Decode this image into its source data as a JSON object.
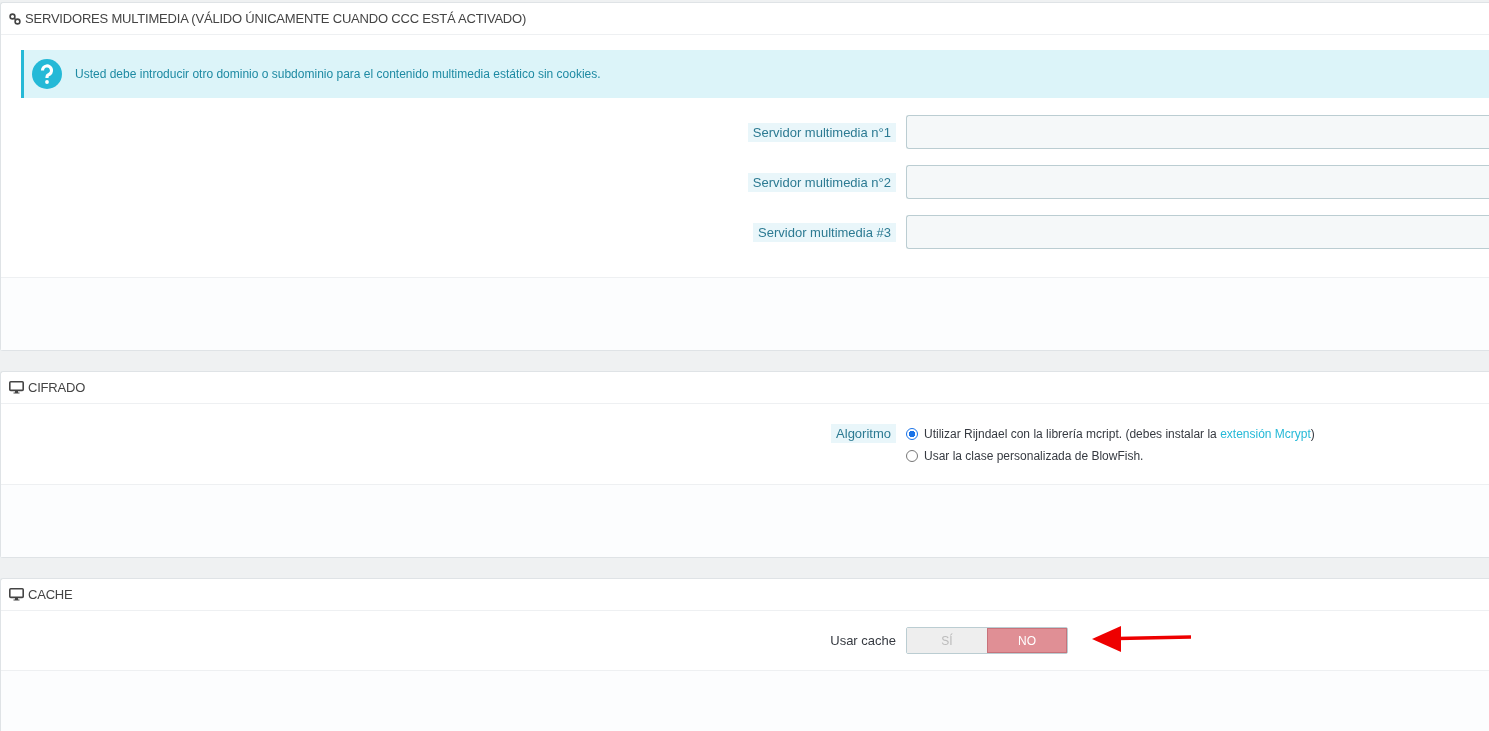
{
  "media_panel": {
    "title": "SERVIDORES MULTIMEDIA (VÁLIDO ÚNICAMENTE CUANDO CCC ESTÁ ACTIVADO)",
    "alert": "Usted debe introducir otro dominio o subdominio para el contenido multimedia estático sin cookies.",
    "fields": [
      {
        "label": "Servidor multimedia n°1"
      },
      {
        "label": "Servidor multimedia n°2"
      },
      {
        "label": "Servidor multimedia #3"
      }
    ]
  },
  "cipher_panel": {
    "title": "CIFRADO",
    "label": "Algoritmo",
    "options": [
      {
        "text": "Utilizar Rijndael con la librería mcript. (debes instalar la ",
        "link": "extensión Mcrypt",
        "after": ")",
        "selected": true
      },
      {
        "text": "Usar la clase personalizada de BlowFish.",
        "selected": false
      }
    ]
  },
  "cache_panel": {
    "title": "CACHE",
    "label": "Usar cache",
    "switch": [
      {
        "label": "SÍ",
        "selected": false
      },
      {
        "label": "NO",
        "selected": true
      }
    ]
  }
}
